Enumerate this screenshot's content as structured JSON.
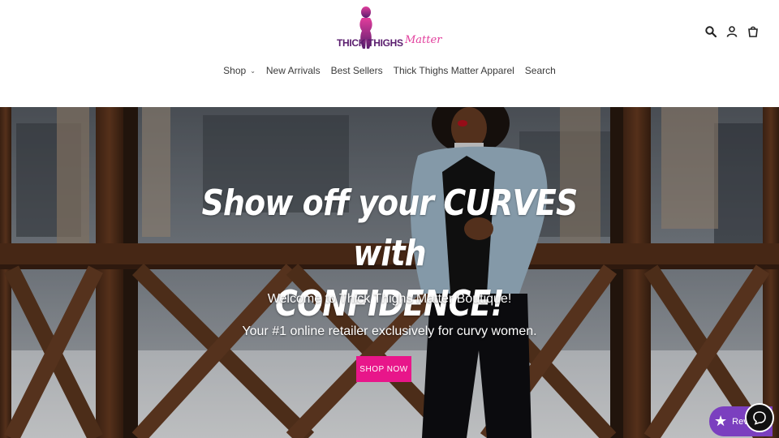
{
  "brand": {
    "logo_main": "THICK THIGHS",
    "logo_script": "Matter",
    "colors": {
      "primary_purple": "#5a1d6e",
      "pink": "#e23d9c",
      "button_pink": "#e8168a",
      "reviews_purple": "#7b3fbf"
    }
  },
  "header": {
    "icons": [
      "search-icon",
      "account-icon",
      "cart-icon"
    ]
  },
  "nav": {
    "items": [
      {
        "label": "Shop",
        "has_dropdown": true
      },
      {
        "label": "New Arrivals"
      },
      {
        "label": "Best Sellers"
      },
      {
        "label": "Thick Thighs Matter Apparel"
      },
      {
        "label": "Search"
      }
    ]
  },
  "hero": {
    "title_line1": "Show off your CURVES with",
    "title_line2": "CONFIDENCE!",
    "subtitle1": "Welcome to Thick Thighs Matter Boutique!",
    "subtitle2": "Your #1 online retailer exclusively for curvy women.",
    "cta_label": "SHOP NOW"
  },
  "widgets": {
    "reviews_label": "Rev",
    "chat_icon": "chat-bubble-icon"
  }
}
